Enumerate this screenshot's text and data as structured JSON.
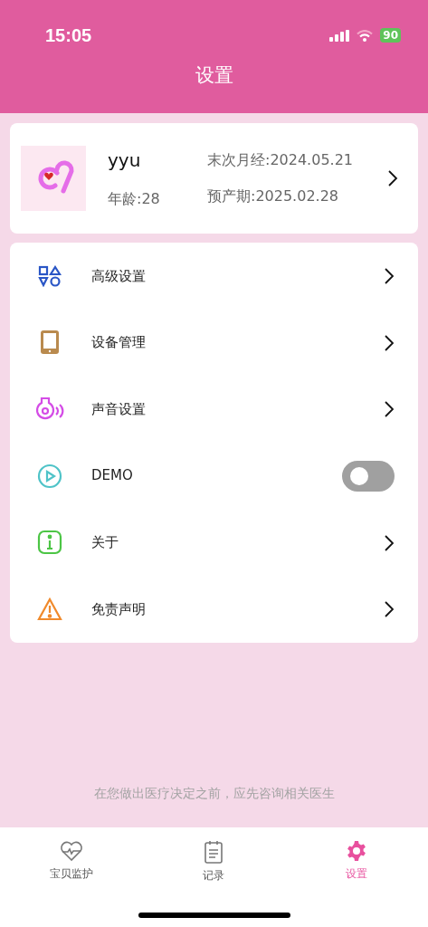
{
  "status_bar": {
    "time": "15:05",
    "battery": "90"
  },
  "header": {
    "title": "设置"
  },
  "profile": {
    "name": "yyu",
    "age": "年龄:28",
    "last_period": "末次月经:2024.05.21",
    "due_date": "预产期:2025.02.28"
  },
  "menu": [
    {
      "kind": "link",
      "label": "高级设置"
    },
    {
      "kind": "link",
      "label": "设备管理"
    },
    {
      "kind": "link",
      "label": "声音设置"
    },
    {
      "kind": "toggle",
      "label": "DEMO",
      "on": false
    },
    {
      "kind": "link",
      "label": "关于"
    },
    {
      "kind": "link",
      "label": "免责声明"
    }
  ],
  "disclaimer": "在您做出医疗决定之前，应先咨询相关医生",
  "tabs": [
    {
      "label": "宝贝监护",
      "selected": false
    },
    {
      "label": "记录",
      "selected": false
    },
    {
      "label": "设置",
      "selected": true
    }
  ]
}
